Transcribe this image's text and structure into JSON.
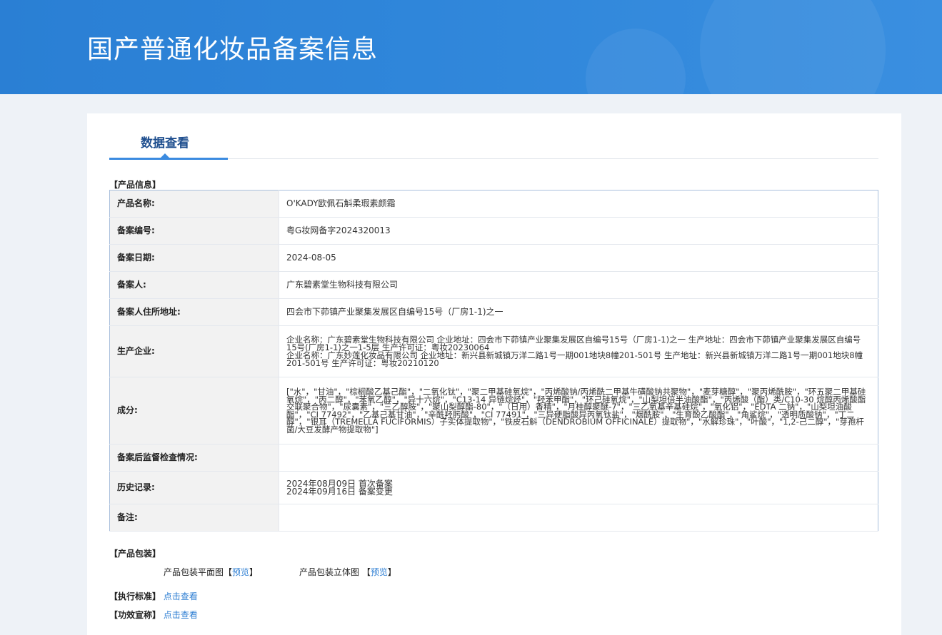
{
  "header": {
    "title": "国产普通化妆品备案信息"
  },
  "tab": {
    "label": "数据查看"
  },
  "product_info": {
    "section_title": "【产品信息】",
    "rows": [
      {
        "label": "产品名称:",
        "value": "O'KADY欧佩石斛柔瑕素颜霜"
      },
      {
        "label": "备案编号:",
        "value": "粤G妆网备字2024320013"
      },
      {
        "label": "备案日期:",
        "value": "2024-08-05"
      },
      {
        "label": "备案人:",
        "value": "广东碧素堂生物科技有限公司"
      },
      {
        "label": "备案人住所地址:",
        "value": "四会市下茆镇产业聚集发展区自编号15号（厂房1-1)之一"
      },
      {
        "label": "生产企业:",
        "value": "企业名称：广东碧素堂生物科技有限公司 企业地址：四会市下茆镇产业聚集发展区自编号15号（厂房1-1)之一 生产地址：四会市下茆镇产业聚集发展区自编号15号(厂房1-1)之一1-5层 生产许可证：粤妆20230064\n企业名称：广东妙莲化妆品有限公司 企业地址：新兴县新城镇万洋二路1号一期001地块8幢201-501号 生产地址：新兴县新城镇万洋二路1号一期001地块8幢201-501号 生产许可证：粤妆20210120"
      },
      {
        "label": "成分:",
        "value": "[\"水\"，\"甘油\"，\"棕榈酸乙基己酯\"，\"二氧化钛\"，\"聚二甲基硅氧烷\"，\"丙烯酸钠/丙烯酰二甲基牛磺酸钠共聚物\"，\"麦芽糖醇\"，\"聚丙烯酰胺\"，\"环五聚二甲基硅氧烷\"，\"丙二醇\"，\"苯氧乙醇\"，\"异十六烷\"，\"C13-14 异链烷烃\"，\"羟苯甲酯\"，\"环己硅氧烷\"，\"山梨坦倍半油酸酯\"，\"丙烯酸（酯）类/C10-30 烷醇丙烯酸酯交联聚合物\"，\"尿囊素\"，\"三乙醇胺\"，\"聚山梨醇酯-80\"，\"（日用）香精\"，\"月桂醇聚醚-7\"，\"三乙氧基辛基硅烷\"，\"氧化铝\"，\"EDTA 二钠\"，\"山梨坦油酸酯\"，\"CI 77492\"，\"乙基己基甘油\"，\"辛酰羟肟酸\"，\"CI 77491\"，\"三异硬脂酸异丙氧钛盐\"，\"烟酰胺\"，\"生育酚乙酸酯\"，\"角鲨烷\"，\"透明质酸钠\"，\"丁二醇\"，\"银耳（TREMELLA FUCIFORMIS）子实体提取物\"，\"铁皮石斛（DENDROBIUM OFFICINALE）提取物\"，\"水解珍珠\"，\"叶酸\"，\"1,2-己二醇\"，\"芽孢杆菌/大豆发酵产物提取物\"]"
      },
      {
        "label": "备案后监督检查情况:",
        "value": ""
      },
      {
        "label": "历史记录:",
        "value": "2024年08月09日 首次备案\n2024年09月16日 备案变更"
      },
      {
        "label": "备注:",
        "value": ""
      }
    ]
  },
  "packaging": {
    "section_title": "【产品包装】",
    "flat_label": "产品包装平面图",
    "solid_label": "产品包装立体图",
    "bracket_open": "【",
    "bracket_close": "】",
    "preview_link": "预览"
  },
  "standard": {
    "label": "【执行标准】",
    "link": "点击查看"
  },
  "efficacy": {
    "label": "【功效宣称】",
    "link": "点击查看"
  },
  "colors": {
    "banner": "#2f86da",
    "accent": "#3b8be0",
    "link": "#2f7fd3",
    "key_bg": "#f2f2f2",
    "table_border": "#a9bfdc"
  }
}
